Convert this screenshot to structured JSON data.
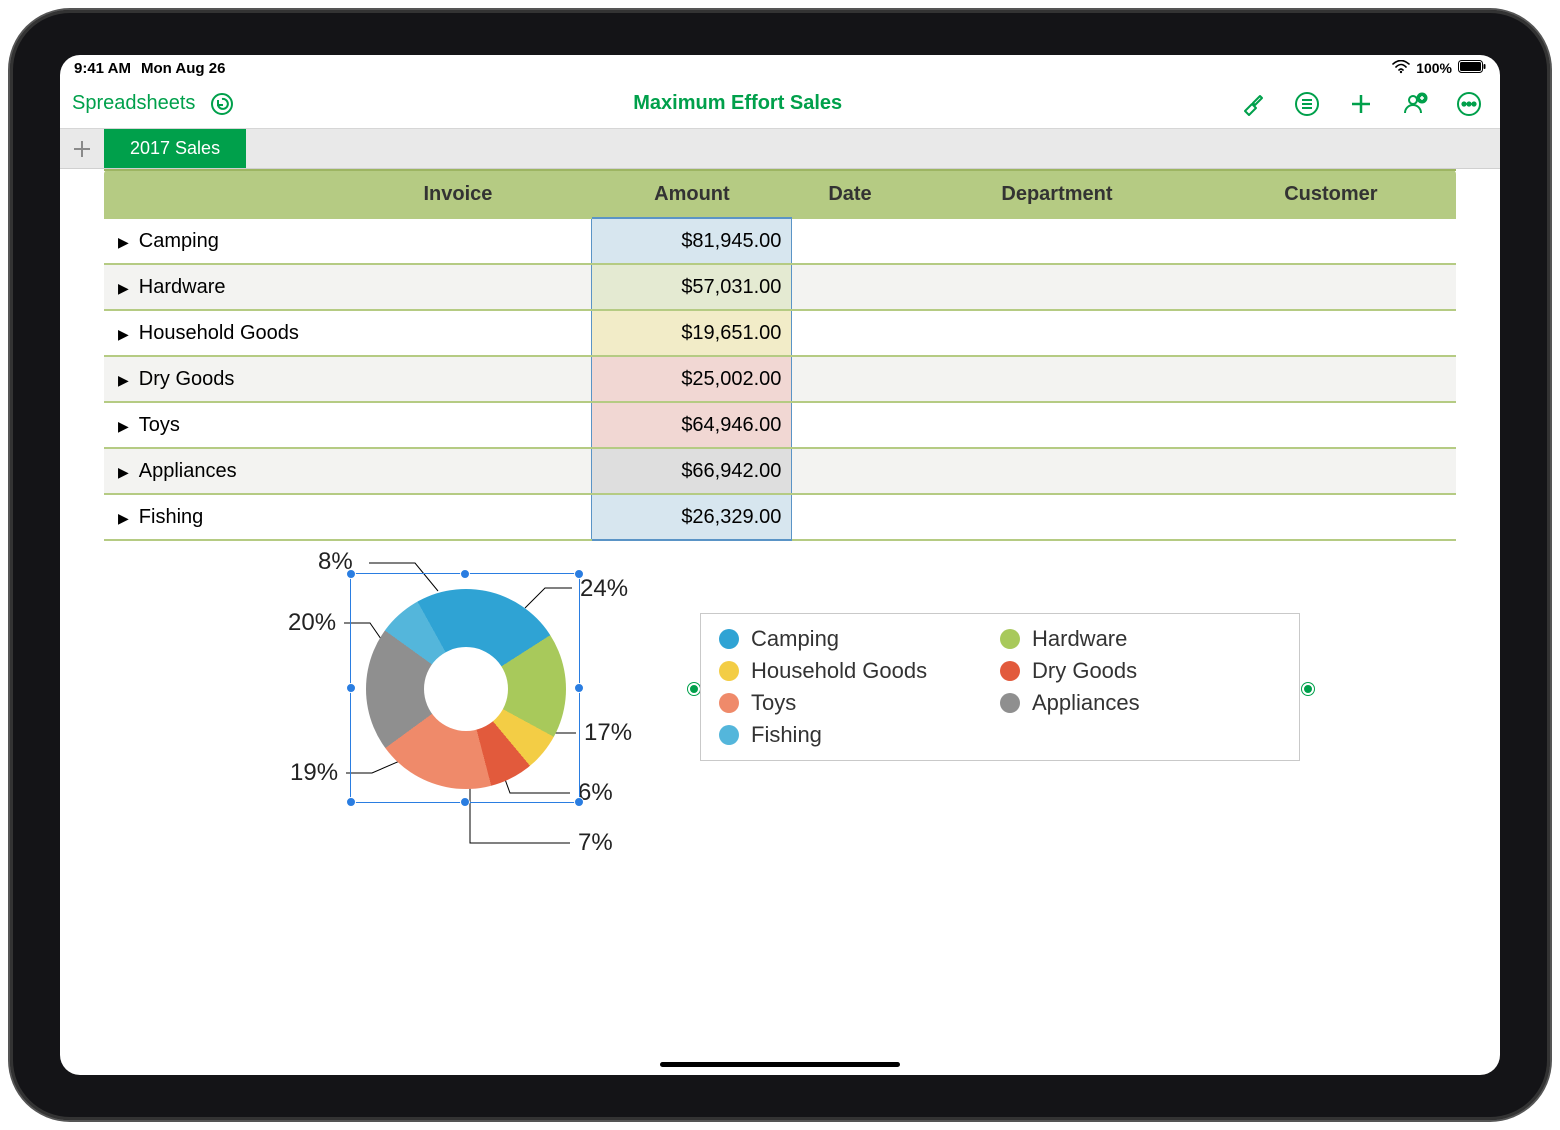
{
  "status": {
    "time": "9:41 AM",
    "date": "Mon Aug 26",
    "battery": "100%"
  },
  "toolbar": {
    "back_label": "Spreadsheets",
    "doc_title": "Maximum Effort Sales"
  },
  "sheet_tab": {
    "name": "2017 Sales"
  },
  "table": {
    "headers": [
      "",
      "Invoice",
      "Amount",
      "Date",
      "Department",
      "Customer"
    ],
    "rows": [
      {
        "category": "Camping",
        "amount": "$81,945.00",
        "cell_bg": "#d7e6ef"
      },
      {
        "category": "Hardware",
        "amount": "$57,031.00",
        "cell_bg": "#e4ead2"
      },
      {
        "category": "Household Goods",
        "amount": "$19,651.00",
        "cell_bg": "#f2ecc8"
      },
      {
        "category": "Dry Goods",
        "amount": "$25,002.00",
        "cell_bg": "#f1d7d3"
      },
      {
        "category": "Toys",
        "amount": "$64,946.00",
        "cell_bg": "#f1d7d3"
      },
      {
        "category": "Appliances",
        "amount": "$66,942.00",
        "cell_bg": "#dedede"
      },
      {
        "category": "Fishing",
        "amount": "$26,329.00",
        "cell_bg": "#d7e6ef"
      }
    ]
  },
  "chart_data": {
    "type": "pie",
    "title": "",
    "series": [
      {
        "name": "Camping",
        "value": 81945,
        "percent": 24,
        "label": "24%",
        "color": "#2fa3d4"
      },
      {
        "name": "Hardware",
        "value": 57031,
        "percent": 17,
        "label": "17%",
        "color": "#a8c95b"
      },
      {
        "name": "Household Goods",
        "value": 19651,
        "percent": 6,
        "label": "6%",
        "color": "#f3cd45"
      },
      {
        "name": "Dry Goods",
        "value": 25002,
        "percent": 7,
        "label": "7%",
        "color": "#e25a3c"
      },
      {
        "name": "Toys",
        "value": 64946,
        "percent": 19,
        "label": "19%",
        "color": "#ef8a6a"
      },
      {
        "name": "Appliances",
        "value": 66942,
        "percent": 20,
        "label": "20%",
        "color": "#8f8f8f"
      },
      {
        "name": "Fishing",
        "value": 26329,
        "percent": 8,
        "label": "8%",
        "color": "#54b6db"
      }
    ],
    "legend_order": [
      "Camping",
      "Hardware",
      "Household Goods",
      "Dry Goods",
      "Toys",
      "Appliances",
      "Fishing"
    ]
  }
}
